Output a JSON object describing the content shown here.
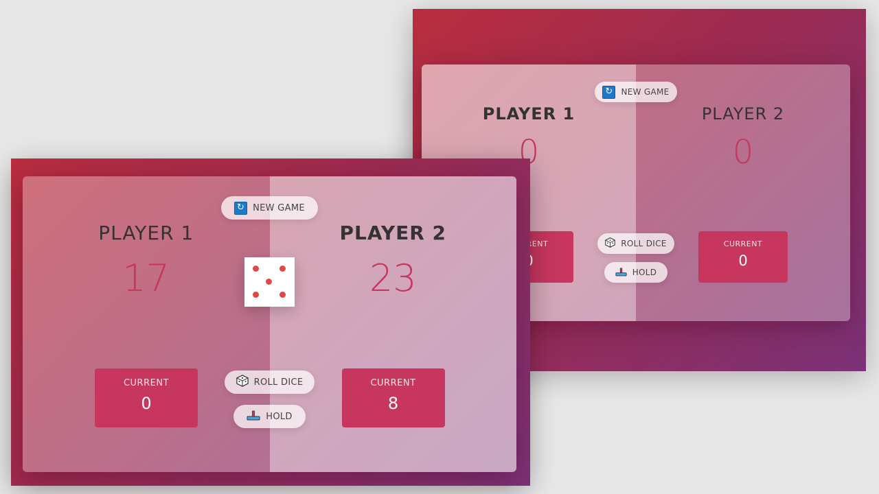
{
  "back_game": {
    "new_game_label": "NEW GAME",
    "roll_dice_label": "ROLL DICE",
    "hold_label": "HOLD",
    "player1": {
      "name": "PLAYER 1",
      "score": "0",
      "current_label": "CURRENT",
      "current_score": "0"
    },
    "player2": {
      "name": "PLAYER 2",
      "score": "0",
      "current_label": "CURRENT",
      "current_score": "0"
    },
    "active_player": 1
  },
  "front_game": {
    "new_game_label": "NEW GAME",
    "roll_dice_label": "ROLL DICE",
    "hold_label": "HOLD",
    "player1": {
      "name": "PLAYER 1",
      "score": "17",
      "current_label": "CURRENT",
      "current_score": "0"
    },
    "player2": {
      "name": "PLAYER 2",
      "score": "23",
      "current_label": "CURRENT",
      "current_score": "8"
    },
    "active_player": 2,
    "dice_value": 5
  },
  "colors": {
    "accent": "#c7365f",
    "dice_pip": "#e04848",
    "background_gradient_start": "#b92d3e",
    "background_gradient_end": "#7b3278"
  },
  "icons": {
    "new_game": "refresh-icon",
    "roll_dice": "dice-icon",
    "hold": "hold-tray-icon"
  }
}
